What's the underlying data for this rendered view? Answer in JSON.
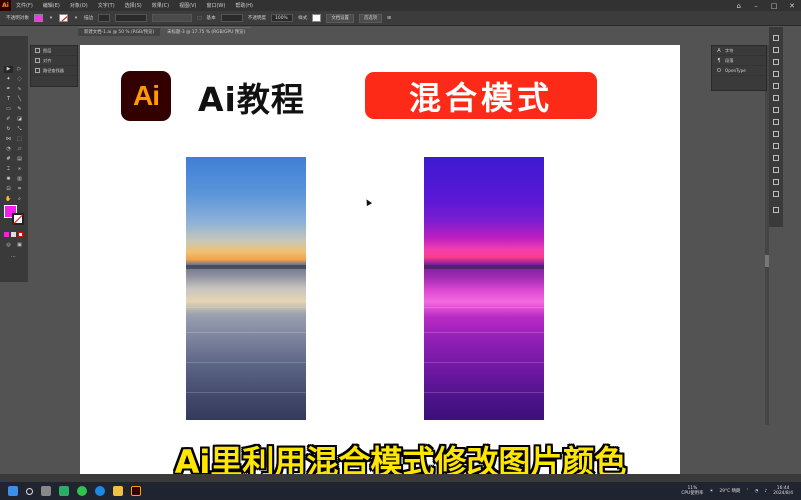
{
  "menu": {
    "items": [
      "文件(F)",
      "编辑(E)",
      "对象(O)",
      "文字(T)",
      "选择(S)",
      "效果(C)",
      "视图(V)",
      "窗口(W)",
      "帮助(H)"
    ],
    "logo": "Ai"
  },
  "control_bar": {
    "selection_label": "不透明对象",
    "stroke_label": "描边",
    "opacity_label": "不透明度",
    "opacity_value": "100%",
    "basic_label": "基本",
    "style_label": "样式",
    "doc_setup": "文档设置",
    "preferences": "首选项",
    "fill_color": "#e83ee0"
  },
  "tabs": [
    {
      "label": "新建文档-1.ai @ 50 % (RGB/预览)",
      "active": false
    },
    {
      "label": "未标题-3 @ 17.75 % (RGB/GPU 预览)",
      "active": true
    }
  ],
  "left_panel": {
    "rows": [
      "图层",
      "对齐",
      "路径查找器"
    ]
  },
  "canvas": {
    "logo_text": "Ai",
    "tutorial_title": "Ai教程",
    "mode_banner": "混合模式",
    "banner_color": "#fe2a18"
  },
  "caption": "Ai里利用混合模式修改图片颜色",
  "right_panel": {
    "rows": [
      "字符",
      "段落",
      "OpenType"
    ]
  },
  "taskbar": {
    "cpu": "11%",
    "cpu_label": "CPU使用率",
    "weather": "29°C 晴朗",
    "time": "16:44",
    "date": "2024/8/4"
  }
}
